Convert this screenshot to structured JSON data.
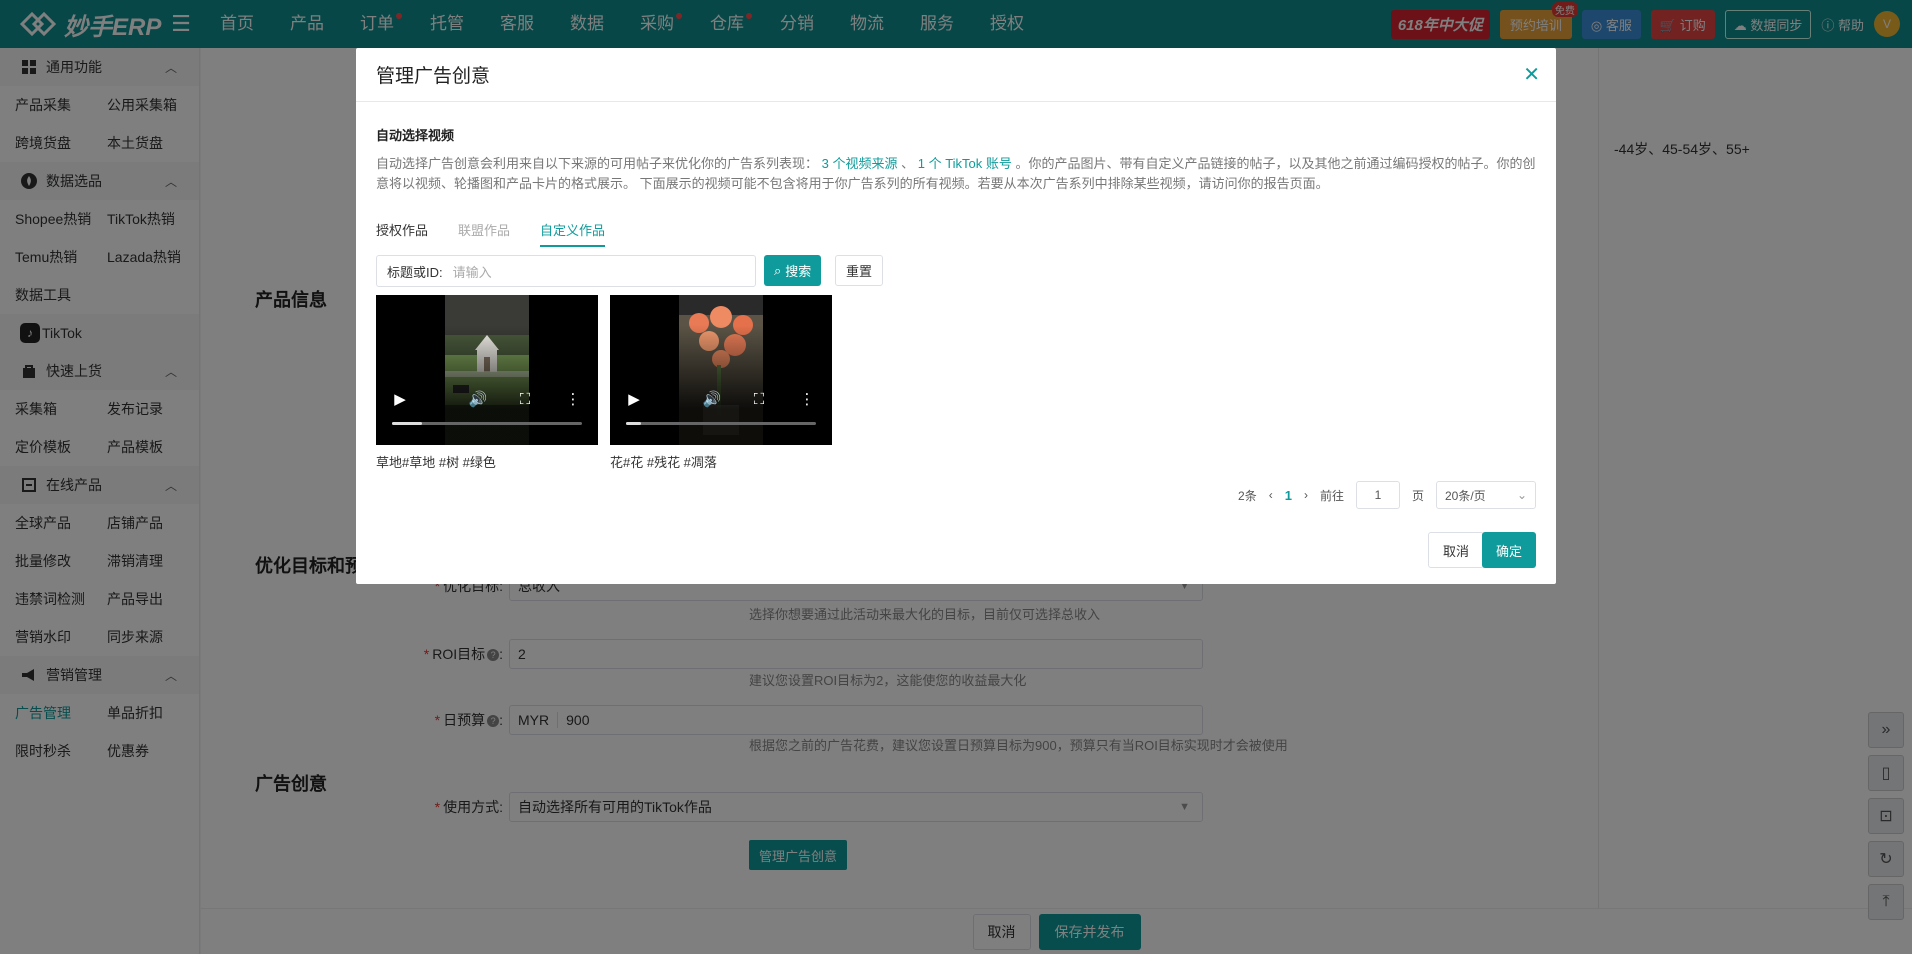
{
  "app": {
    "title": "妙手ERP"
  },
  "topnav": {
    "items": [
      {
        "label": "首页",
        "dot": false
      },
      {
        "label": "产品",
        "dot": false
      },
      {
        "label": "订单",
        "dot": true
      },
      {
        "label": "托管",
        "dot": false
      },
      {
        "label": "客服",
        "dot": false
      },
      {
        "label": "数据",
        "dot": false
      },
      {
        "label": "采购",
        "dot": true
      },
      {
        "label": "仓库",
        "dot": true
      },
      {
        "label": "分销",
        "dot": false
      },
      {
        "label": "物流",
        "dot": false
      },
      {
        "label": "服务",
        "dot": false
      },
      {
        "label": "授权",
        "dot": false
      }
    ],
    "promo": "618年中大促",
    "training": "预约培训",
    "training_tag": "免费",
    "kefu": "客服",
    "order": "订购",
    "sync": "数据同步",
    "help": "帮助",
    "avatar_letter": "V"
  },
  "sidebar": {
    "group1": {
      "title": "通用功能",
      "icon": "grid-icon",
      "rows": [
        [
          "产品采集",
          "公用采集箱"
        ],
        [
          "跨境货盘",
          "本土货盘"
        ]
      ]
    },
    "group2": {
      "title": "数据选品",
      "icon": "fire-icon",
      "rows": [
        [
          "Shopee热销",
          "TikTok热销"
        ],
        [
          "Temu热销",
          "Lazada热销"
        ],
        [
          "数据工具",
          ""
        ]
      ]
    },
    "tiktok": "TikTok",
    "group3": {
      "title": "快速上货",
      "icon": "bag-icon",
      "rows": [
        [
          "采集箱",
          "发布记录"
        ],
        [
          "定价模板",
          "产品模板"
        ]
      ]
    },
    "group4": {
      "title": "在线产品",
      "icon": "box-icon",
      "rows": [
        [
          "全球产品",
          "店铺产品"
        ],
        [
          "批量修改",
          "滞销清理"
        ],
        [
          "违禁词检测",
          "产品导出"
        ],
        [
          "营销水印",
          "同步来源"
        ]
      ]
    },
    "group5": {
      "title": "营销管理",
      "icon": "megaphone-icon",
      "rows": [
        [
          "广告管理",
          "单品折扣"
        ],
        [
          "限时秒杀",
          "优惠券"
        ]
      ]
    }
  },
  "form": {
    "section_product": "产品信息",
    "section_goal": "优化目标和预算",
    "section_creative": "广告创意",
    "goal_label": "优化目标:",
    "goal_value": "总收入",
    "goal_hint": "选择你想要通过此活动来最大化的目标，目前仅可选择总收入",
    "roi_label": "ROI目标",
    "roi_value": "2",
    "roi_hint": "建议您设置ROI目标为2，这能使您的收益最大化",
    "budget_label": "日预算",
    "budget_currency": "MYR",
    "budget_value": "900",
    "budget_hint": "根据您之前的广告花费，建议您设置日预算目标为900，预算只有当ROI目标实现时才会被使用",
    "mode_label": "使用方式:",
    "mode_value": "自动选择所有可用的TikTok作品",
    "manage_btn": "管理广告创意",
    "right_snippet": "-44岁、45-54岁、55+"
  },
  "footer": {
    "cancel": "取消",
    "save": "保存并发布"
  },
  "modal": {
    "title": "管理广告创意",
    "subtitle": "自动选择视频",
    "desc_before": "自动选择广告创意会利用来自以下来源的可用帖子来优化你的广告系列表现：",
    "link_sources": "3 个视频来源",
    "sep": "、",
    "link_account": "1 个 TikTok 账号",
    "desc_after": "。你的产品图片、带有自定义产品链接的帖子，以及其他之前通过编码授权的帖子。你的创意将以视频、轮播图和产品卡片的格式展示。 下面展示的视频可能不包含将用于你广告系列的所有视频。若要从本次广告系列中排除某些视频，请访问你的报告页面。",
    "tabs": [
      "授权作品",
      "联盟作品",
      "自定义作品"
    ],
    "search_label": "标题或ID:",
    "search_placeholder": "请输入",
    "search_btn": "搜索",
    "reset_btn": "重置",
    "videos": [
      {
        "caption": "草地#草地 #树 #绿色",
        "progress": 0.16
      },
      {
        "caption": "花#花 #残花 #凋落",
        "progress": 0.08
      }
    ],
    "pager": {
      "total": "2条",
      "current": "1",
      "goto": "前往",
      "page_input": "1",
      "page_unit": "页",
      "page_size": "20条/页"
    },
    "cancel": "取消",
    "ok": "确定"
  }
}
